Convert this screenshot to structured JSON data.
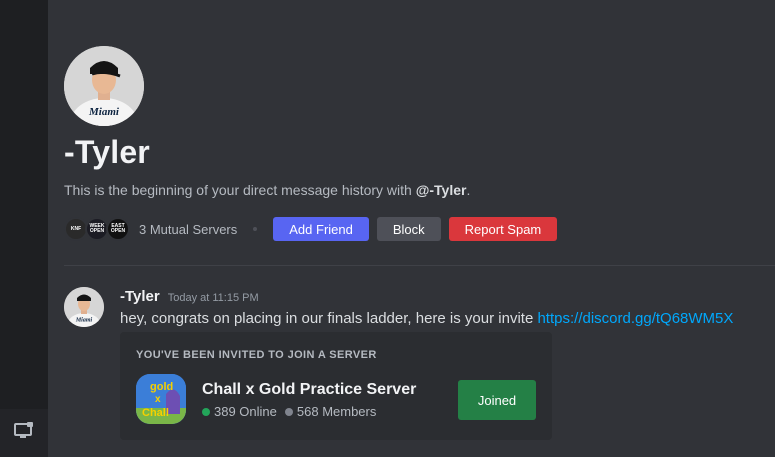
{
  "colors": {
    "background": "#313338",
    "rail": "#1e1f22",
    "add_friend": "#5865f2",
    "block": "#4e5058",
    "report_spam": "#da373c",
    "joined": "#248046",
    "link": "#00a8fc",
    "online": "#23a55a",
    "members": "#80848e"
  },
  "rail": {
    "icon": "monitor-icon"
  },
  "profile": {
    "username": "-Tyler",
    "avatar_jersey_text": "Miami",
    "intro_prefix": "This is the beginning of your direct message history with ",
    "intro_handle": "@-Tyler",
    "intro_suffix": "."
  },
  "mutual": {
    "server_icons": [
      "KNF",
      "WEEK OPEN",
      "EAST OPEN"
    ],
    "label": "3 Mutual Servers"
  },
  "actions": {
    "add_friend": "Add Friend",
    "block": "Block",
    "report_spam": "Report Spam"
  },
  "message": {
    "author": "-Tyler",
    "timestamp": "Today at 11:15 PM",
    "text": "hey, congrats on placing in our finals ladder, here is your invite ",
    "link": "https://discord.gg/tQ68WM5X"
  },
  "invite": {
    "header": "YOU'VE BEEN INVITED TO JOIN A SERVER",
    "server_name": "Chall x Gold Practice Server",
    "icon_text": [
      "gold",
      "x",
      "Chall"
    ],
    "online": "389 Online",
    "members": "568 Members",
    "button": "Joined"
  }
}
